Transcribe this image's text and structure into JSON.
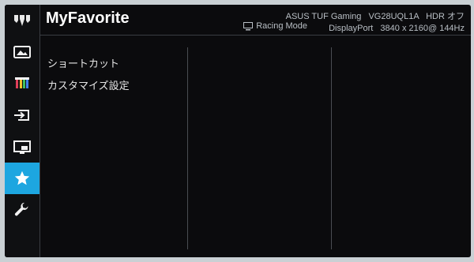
{
  "header": {
    "title": "MyFavorite",
    "brand": "ASUS TUF Gaming",
    "model": "VG28UQL1A",
    "hdr_status": "HDR オフ",
    "mode": "Racing Mode",
    "input": "DisplayPort",
    "resolution": "3840 x 2160@ 144Hz"
  },
  "sidebar": {
    "items": [
      {
        "icon": "image-icon"
      },
      {
        "icon": "color-bars-icon"
      },
      {
        "icon": "input-select-icon"
      },
      {
        "icon": "pip-icon"
      },
      {
        "icon": "star-icon",
        "active": true
      },
      {
        "icon": "wrench-icon"
      }
    ],
    "active_color": "#1da6e0"
  },
  "menu": {
    "items": [
      "ショートカット",
      "カスタマイズ設定"
    ]
  }
}
